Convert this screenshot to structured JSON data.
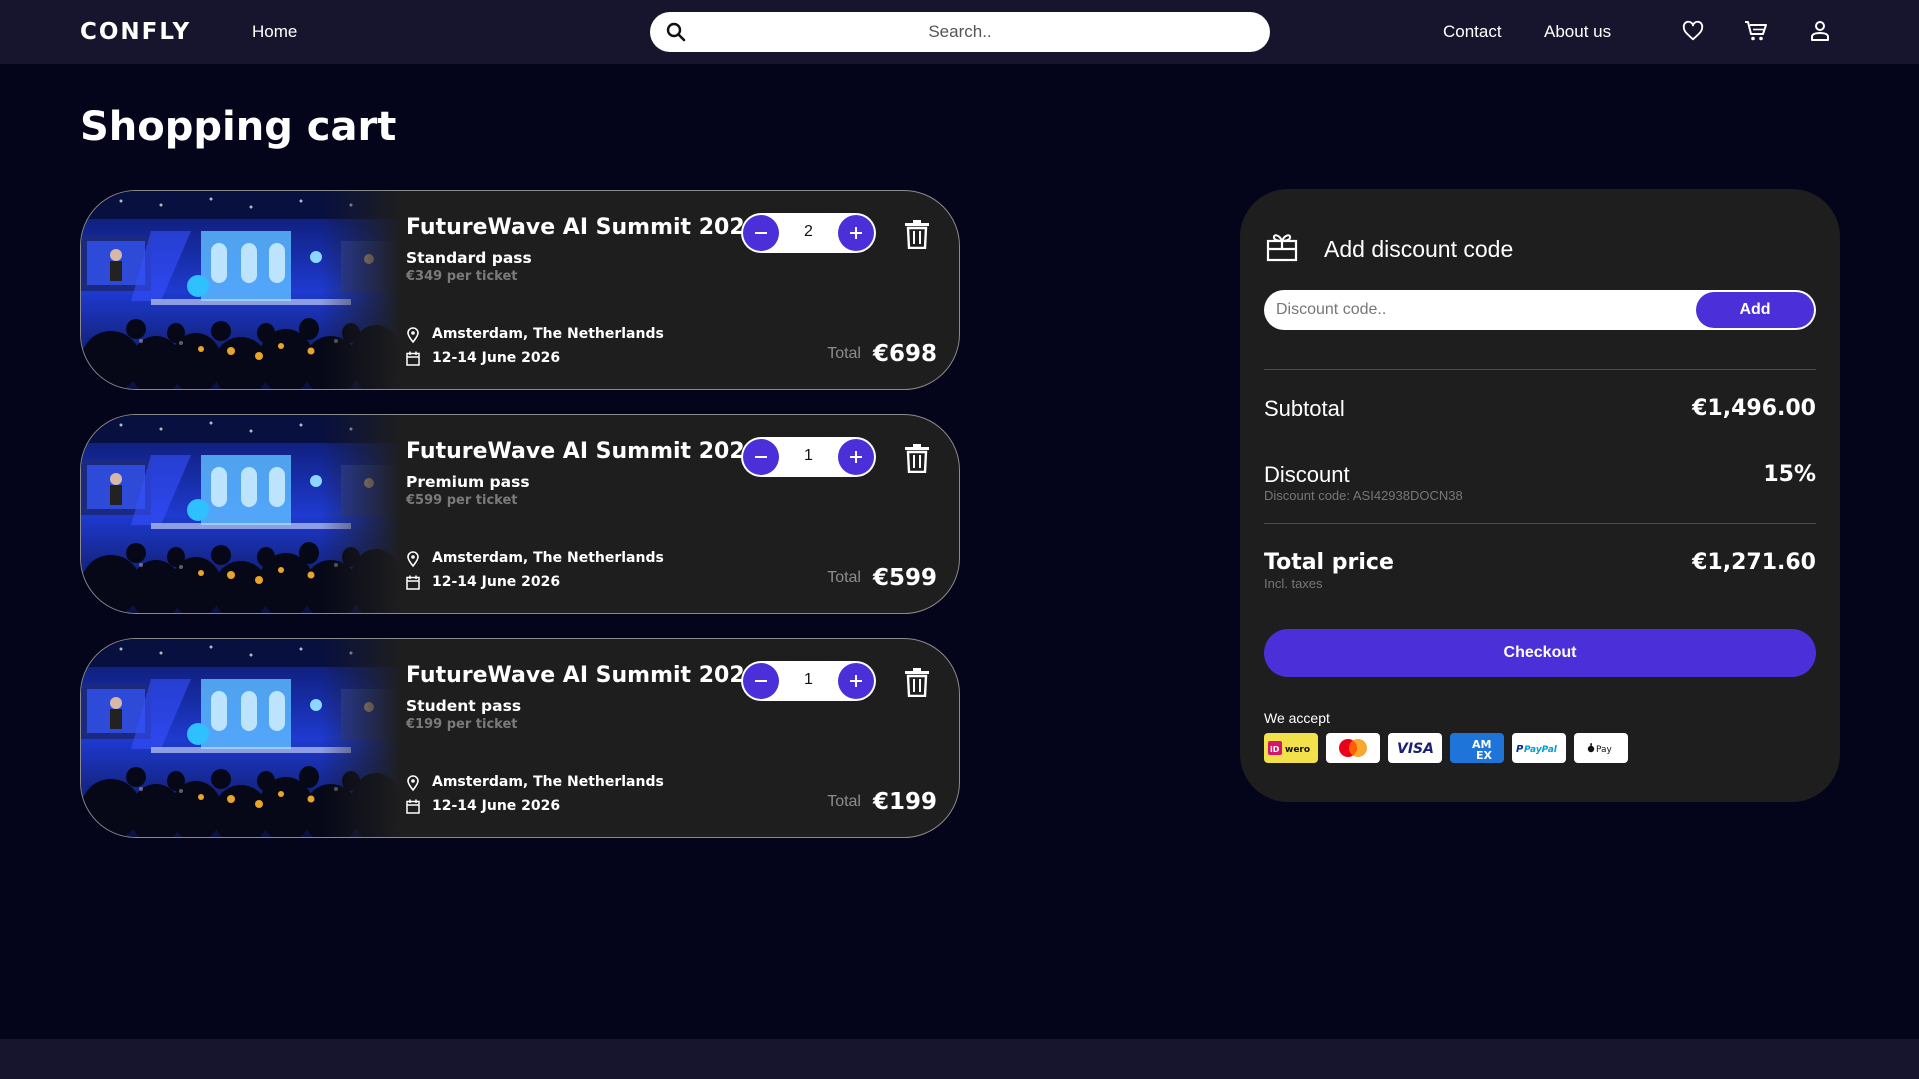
{
  "nav": {
    "logo": "CONFLY",
    "home": "Home",
    "search_placeholder": "Search..",
    "contact": "Contact",
    "about": "About us"
  },
  "page": {
    "title": "Shopping cart"
  },
  "cart": {
    "items": [
      {
        "title": "FutureWave AI Summit 2026",
        "pass": "Standard pass",
        "price": "€349 per ticket",
        "location": "Amsterdam, The Netherlands",
        "date": "12-14 June 2026",
        "quantity": "2",
        "total_label": "Total",
        "total": "€698"
      },
      {
        "title": "FutureWave AI Summit 2026",
        "pass": "Premium pass",
        "price": "€599 per ticket",
        "location": "Amsterdam, The Netherlands",
        "date": "12-14 June 2026",
        "quantity": "1",
        "total_label": "Total",
        "total": "€599"
      },
      {
        "title": "FutureWave AI Summit 2026",
        "pass": "Student pass",
        "price": "€199 per ticket",
        "location": "Amsterdam, The Netherlands",
        "date": "12-14 June 2026",
        "quantity": "1",
        "total_label": "Total",
        "total": "€199"
      }
    ]
  },
  "summary": {
    "discount_heading": "Add discount code",
    "discount_placeholder": "Discount code..",
    "add_label": "Add",
    "subtotal_label": "Subtotal",
    "subtotal": "€1,496.00",
    "discount_label": "Discount",
    "discount_code_text": "Discount code: ASI42938DOCN38",
    "discount_value": "15%",
    "total_label": "Total price",
    "total_sub": "Incl. taxes",
    "total": "€1,271.60",
    "checkout_label": "Checkout",
    "accept_label": "We accept",
    "payment_methods": [
      "iDEAL wero",
      "Mastercard",
      "VISA",
      "American Express",
      "PayPal",
      "Apple Pay"
    ]
  },
  "colors": {
    "background": "#04041a",
    "nav": "#17152d",
    "card": "#1e1e1e",
    "accent": "#4b2fd9"
  }
}
